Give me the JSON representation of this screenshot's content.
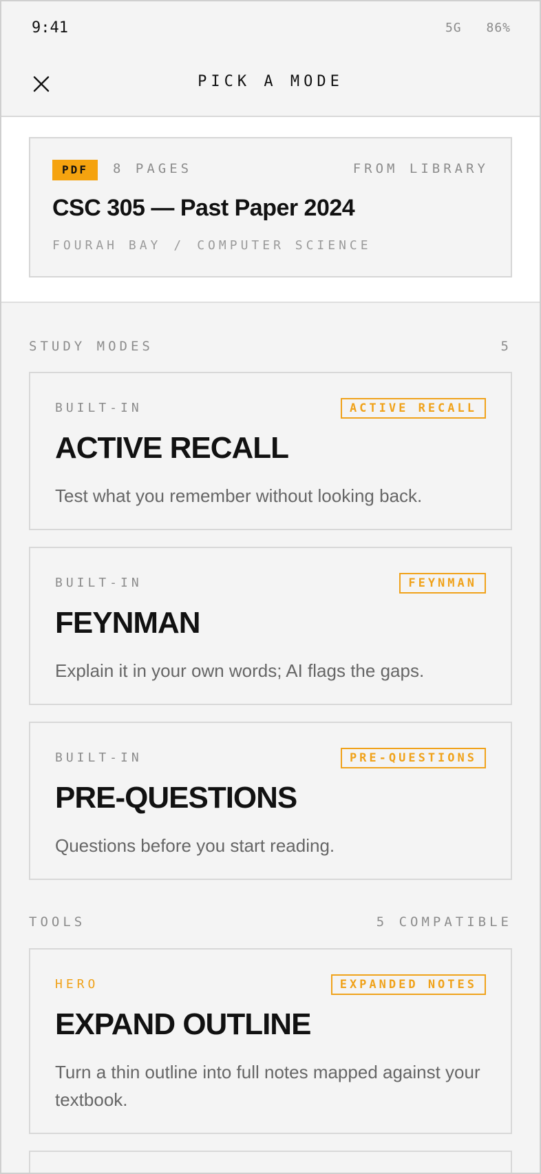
{
  "status_bar": {
    "time": "9:41",
    "network": "5G",
    "battery": "86%"
  },
  "header": {
    "title": "PICK A MODE",
    "close_icon": "close-icon"
  },
  "document": {
    "type_badge": "PDF",
    "pages": "8 PAGES",
    "source": "FROM LIBRARY",
    "title": "CSC 305 — Past Paper 2024",
    "institution": "FOURAH BAY",
    "separator": "/",
    "department": "COMPUTER SCIENCE"
  },
  "study_modes": {
    "label": "STUDY MODES",
    "count": "5",
    "items": [
      {
        "kind": "BUILT-IN",
        "tag": "ACTIVE RECALL",
        "name": "ACTIVE RECALL",
        "description": "Test what you remember without looking back."
      },
      {
        "kind": "BUILT-IN",
        "tag": "FEYNMAN",
        "name": "FEYNMAN",
        "description": "Explain it in your own words; AI flags the gaps."
      },
      {
        "kind": "BUILT-IN",
        "tag": "PRE-QUESTIONS",
        "name": "PRE-QUESTIONS",
        "description": "Questions before you start reading."
      }
    ]
  },
  "tools": {
    "label": "TOOLS",
    "count": "5 COMPATIBLE",
    "items": [
      {
        "kind": "HERO",
        "tag": "EXPANDED NOTES",
        "name": "EXPAND OUTLINE",
        "description": "Turn a thin outline into full notes mapped against your textbook."
      }
    ]
  },
  "colors": {
    "accent": "#f5a30f",
    "text": "#111111",
    "muted": "#8c8c8c",
    "background": "#f4f4f4"
  }
}
